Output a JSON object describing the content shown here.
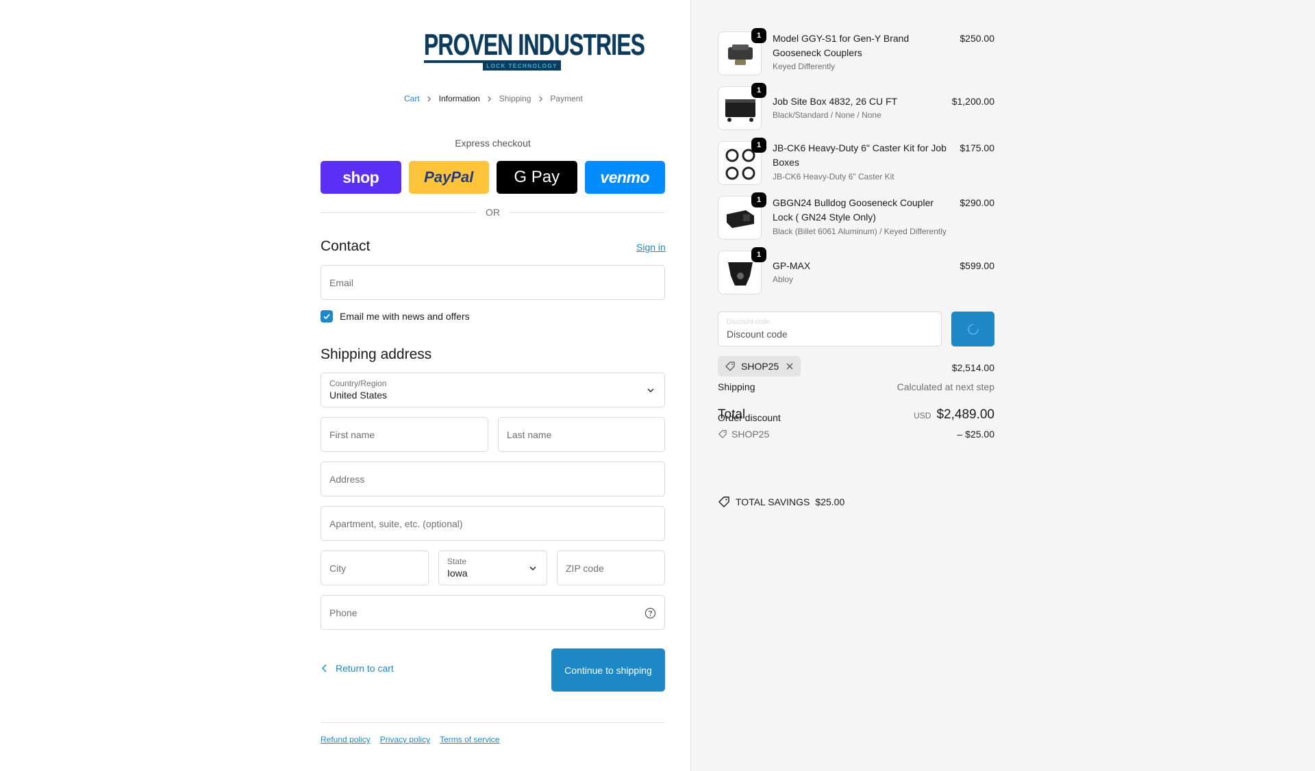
{
  "logo": {
    "main": "PROVEN INDUSTRIES",
    "sub": "LOCK TECHNOLOGY"
  },
  "breadcrumb": [
    "Cart",
    "Information",
    "Shipping",
    "Payment"
  ],
  "express": {
    "title": "Express checkout",
    "buttons": [
      "shop",
      "PayPal",
      "G Pay",
      "venmo"
    ],
    "or": "OR"
  },
  "contact": {
    "title": "Contact",
    "signin": "Sign in",
    "email_placeholder": "Email",
    "newsletter_label": "Email me with news and offers",
    "newsletter_checked": true
  },
  "shipping": {
    "title": "Shipping address",
    "country_label": "Country/Region",
    "country_value": "United States",
    "first_name": "First name",
    "last_name": "Last name",
    "address": "Address",
    "apartment": "Apartment, suite, etc. (optional)",
    "city": "City",
    "state_label": "State",
    "state_value": "Iowa",
    "zip": "ZIP code",
    "phone": "Phone"
  },
  "actions": {
    "return": "Return to cart",
    "continue": "Continue to shipping"
  },
  "footer": [
    "Refund policy",
    "Privacy policy",
    "Terms of service"
  ],
  "products": [
    {
      "name": "Model GGY-S1 for Gen-Y Brand Gooseneck Couplers",
      "variant": "Keyed Differently",
      "price": "$250.00",
      "qty": "1"
    },
    {
      "name": "Job Site Box 4832, 26 CU FT",
      "variant": "Black/Standard / None / None",
      "price": "$1,200.00",
      "qty": "1"
    },
    {
      "name": "JB-CK6 Heavy-Duty 6\" Caster Kit for Job Boxes",
      "variant": "JB-CK6 Heavy-Duty 6\" Caster Kit",
      "price": "$175.00",
      "qty": "1"
    },
    {
      "name": "GBGN24 Bulldog Gooseneck Coupler Lock ( GN24 Style Only)",
      "variant": "Black (Billet 6061 Aluminum) / Keyed Differently",
      "price": "$290.00",
      "qty": "1"
    },
    {
      "name": "GP-MAX",
      "variant": "Abloy",
      "price": "$599.00",
      "qty": "1"
    }
  ],
  "discount": {
    "ghost_label": "Discount code",
    "placeholder": "Discount code",
    "applied_code": "SHOP25"
  },
  "summary": {
    "subtotal": "$2,514.00",
    "shipping_label": "Shipping",
    "shipping_value": "Calculated at next step",
    "total_label": "Total",
    "order_discount_label": "Order discount",
    "currency": "USD",
    "total": "$2,489.00",
    "discount_code": "SHOP25",
    "discount_amount": "– $25.00",
    "savings_label": "TOTAL SAVINGS",
    "savings_amount": "$25.00"
  },
  "colors": {
    "accent": "#1e88c7",
    "shop": "#5a31f4",
    "paypal": "#ffc439",
    "gpay": "#000000",
    "venmo": "#008cff"
  }
}
